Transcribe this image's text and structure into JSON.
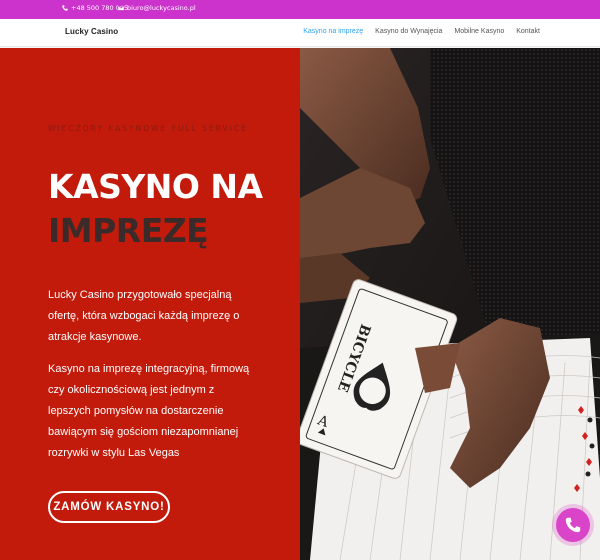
{
  "topbar": {
    "phone": "+48 500 780 005",
    "email": "biuro@luckycasino.pl"
  },
  "nav": {
    "logo": "Lucky Casino",
    "items": [
      {
        "label": "Kasyno na imprezę",
        "active": true
      },
      {
        "label": "Kasyno do Wynajęcia",
        "active": false
      },
      {
        "label": "Mobilne Kasyno",
        "active": false
      },
      {
        "label": "Kontakt",
        "active": false
      }
    ]
  },
  "hero": {
    "eyebrow": "WIECZORY KASYNOWE FULL SERVICE",
    "title_line1": "KASYNO NA",
    "title_line2": "IMPREZĘ",
    "paragraph1": "Lucky Casino przygotowało specjalną ofertę, która wzbogaci każdą imprezę o atrakcje kasynowe.",
    "paragraph2": "Kasyno na imprezę integracyjną, firmową czy okolicznościową jest jednym z lepszych pomysłów na dostarczenie bawiącym się gościom niezapomnianej rozrywki w stylu Las Vegas",
    "cta": "ZAMÓW KASYNO!",
    "card_brand": "BICYCLE",
    "colors": {
      "panel": "#c21b0c",
      "title_dark": "#3a2b2a"
    }
  },
  "topbar_color": "#cc33cc",
  "nav_active_color": "#2ea3f2",
  "chat_button": {
    "icon": "phone-icon",
    "color": "#d944c8"
  }
}
